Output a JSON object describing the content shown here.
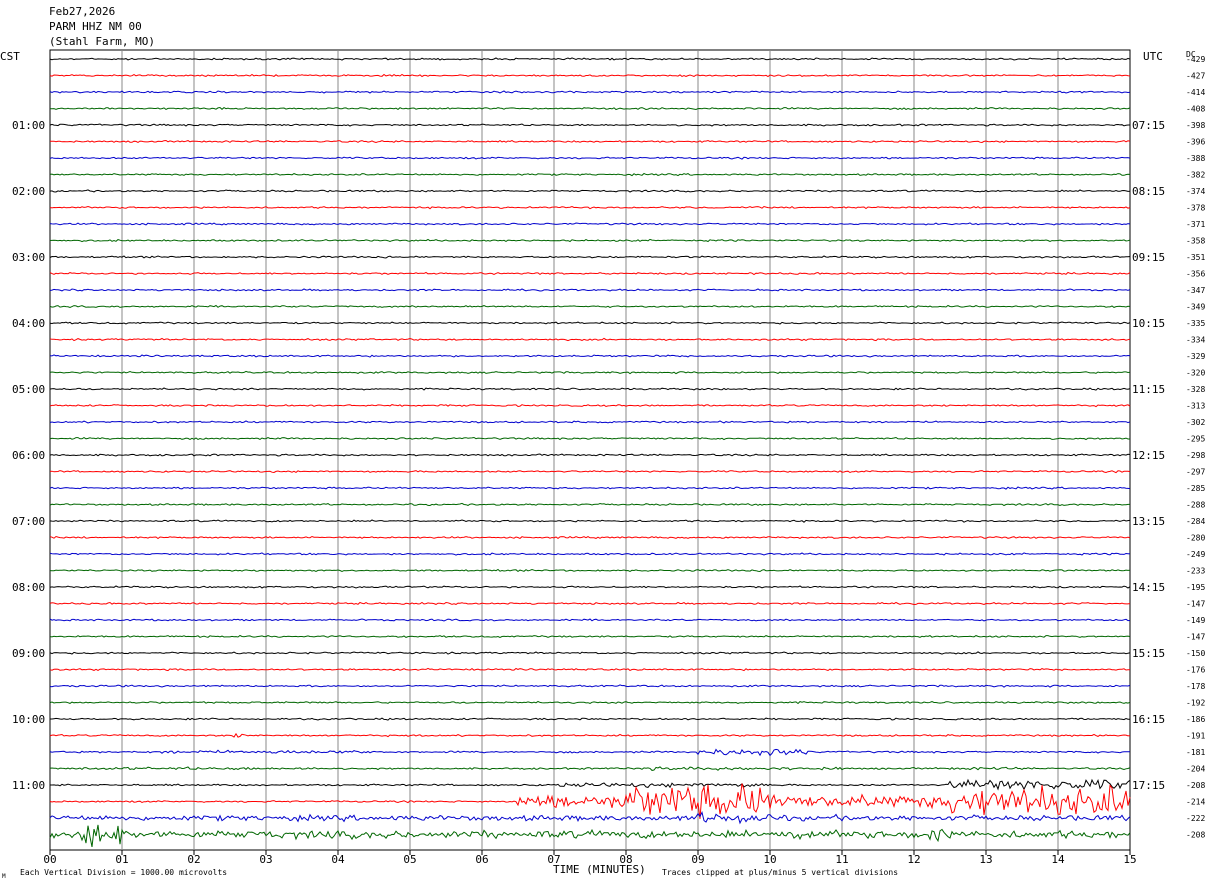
{
  "header": {
    "date": "Feb27,2026",
    "station": "PARM HHZ NM 00",
    "location": "(Stahl Farm, MO)"
  },
  "labels": {
    "left_tz": "CST",
    "right_tz": "UTC",
    "dc": "DC",
    "xlabel": "TIME (MINUTES)",
    "footer_left": "Each Vertical Division = 1000.00 microvolts",
    "footer_right": "Traces clipped at plus/minus 5 vertical divisions",
    "corner_mark": "M"
  },
  "chart_data": {
    "type": "line",
    "title": "PARM HHZ NM 00",
    "xlabel": "TIME (MINUTES)",
    "xlim": [
      0,
      15
    ],
    "x_ticks": [
      "00",
      "01",
      "02",
      "03",
      "04",
      "05",
      "06",
      "07",
      "08",
      "09",
      "10",
      "11",
      "12",
      "13",
      "14",
      "15"
    ],
    "trace_colors": [
      "#000000",
      "#ff0000",
      "#0000cc",
      "#006600"
    ],
    "left_times": [
      "01:00",
      "02:00",
      "03:00",
      "04:00",
      "05:00",
      "06:00",
      "07:00",
      "08:00",
      "09:00",
      "10:00",
      "11:00"
    ],
    "right_times": [
      "07:15",
      "08:15",
      "09:15",
      "10:15",
      "11:15",
      "12:15",
      "13:15",
      "14:15",
      "15:15",
      "16:15",
      "17:15"
    ],
    "dc_offsets": [
      -429,
      -427,
      -414,
      -408,
      -398,
      -396,
      -388,
      -382,
      -374,
      -378,
      -371,
      -358,
      -351,
      -356,
      -347,
      -349,
      -335,
      -334,
      -329,
      -320,
      -328,
      -313,
      -302,
      -295,
      -298,
      -297,
      -285,
      -288,
      -284,
      -280,
      -249,
      -233,
      -195,
      -147,
      -149,
      -147,
      -150,
      -176,
      -178,
      -192,
      -186,
      -191,
      -181,
      -204,
      -208,
      -214,
      -222,
      -208
    ],
    "trace_count": 48,
    "grid": true
  }
}
